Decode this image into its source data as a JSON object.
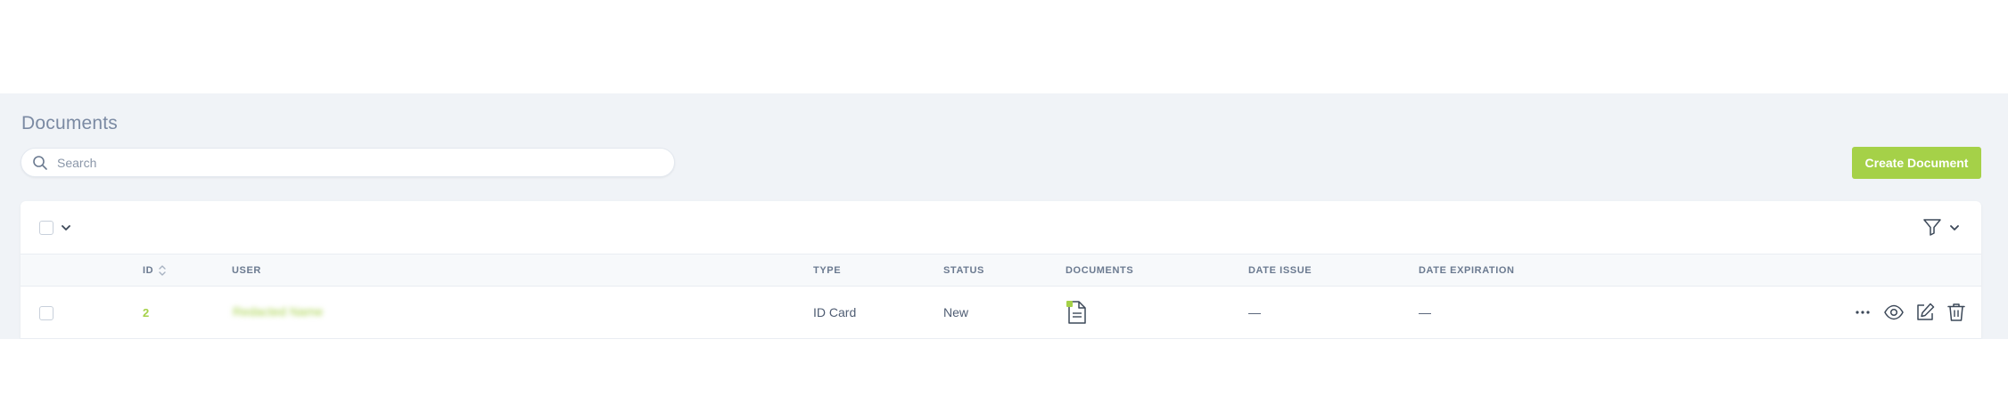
{
  "page": {
    "title": "Documents"
  },
  "search": {
    "placeholder": "Search",
    "value": ""
  },
  "actions": {
    "create_label": "Create Document"
  },
  "colors": {
    "accent": "#a5d148",
    "background": "#f0f3f7",
    "text": "#4f5d73",
    "muted": "#7b8aa3"
  },
  "table": {
    "columns": [
      "ID",
      "USER",
      "TYPE",
      "STATUS",
      "DOCUMENTS",
      "DATE ISSUE",
      "DATE EXPIRATION"
    ],
    "rows": [
      {
        "id": "2",
        "user": "Redacted Name",
        "type": "ID Card",
        "status": "New",
        "documents_icon": "document-file-icon",
        "date_issue": "—",
        "date_expiration": "—"
      }
    ]
  },
  "icons": {
    "search": "search-icon",
    "bulk": "chevron-down-icon",
    "filter": "filter-icon",
    "sort": "sort-icon",
    "more": "more-icon",
    "view": "eye-icon",
    "edit": "edit-icon",
    "delete": "trash-icon"
  }
}
